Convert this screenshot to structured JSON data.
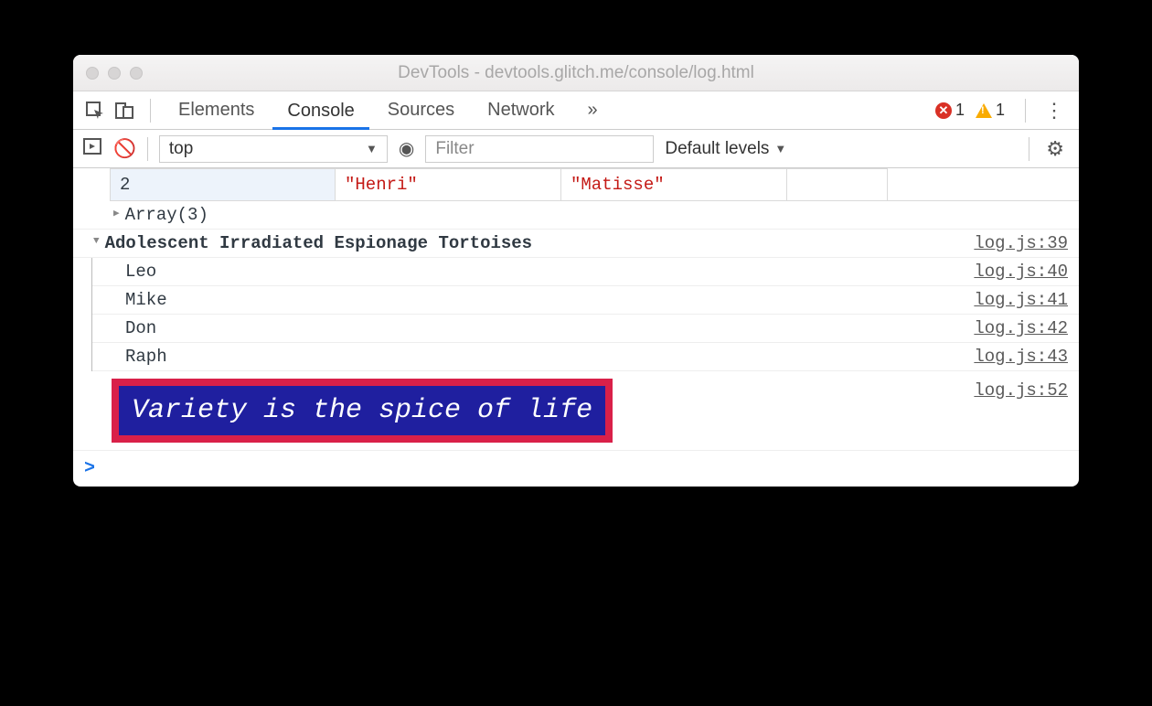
{
  "window": {
    "title": "DevTools - devtools.glitch.me/console/log.html"
  },
  "tabs": {
    "elements": "Elements",
    "console": "Console",
    "sources": "Sources",
    "network": "Network",
    "overflow": "»"
  },
  "status": {
    "error_count": "1",
    "warning_count": "1"
  },
  "filterbar": {
    "context": "top",
    "filter_placeholder": "Filter",
    "levels": "Default levels"
  },
  "console": {
    "table_row": {
      "idx": "2",
      "first": "\"Henri\"",
      "last": "\"Matisse\""
    },
    "array_summary": "Array(3)",
    "group": {
      "title": "Adolescent Irradiated Espionage Tortoises",
      "src": "log.js:39",
      "items": [
        {
          "text": "Leo",
          "src": "log.js:40"
        },
        {
          "text": "Mike",
          "src": "log.js:41"
        },
        {
          "text": "Don",
          "src": "log.js:42"
        },
        {
          "text": "Raph",
          "src": "log.js:43"
        }
      ]
    },
    "styled": {
      "text": "Variety is the spice of life",
      "src": "log.js:52"
    },
    "prompt": ">"
  }
}
